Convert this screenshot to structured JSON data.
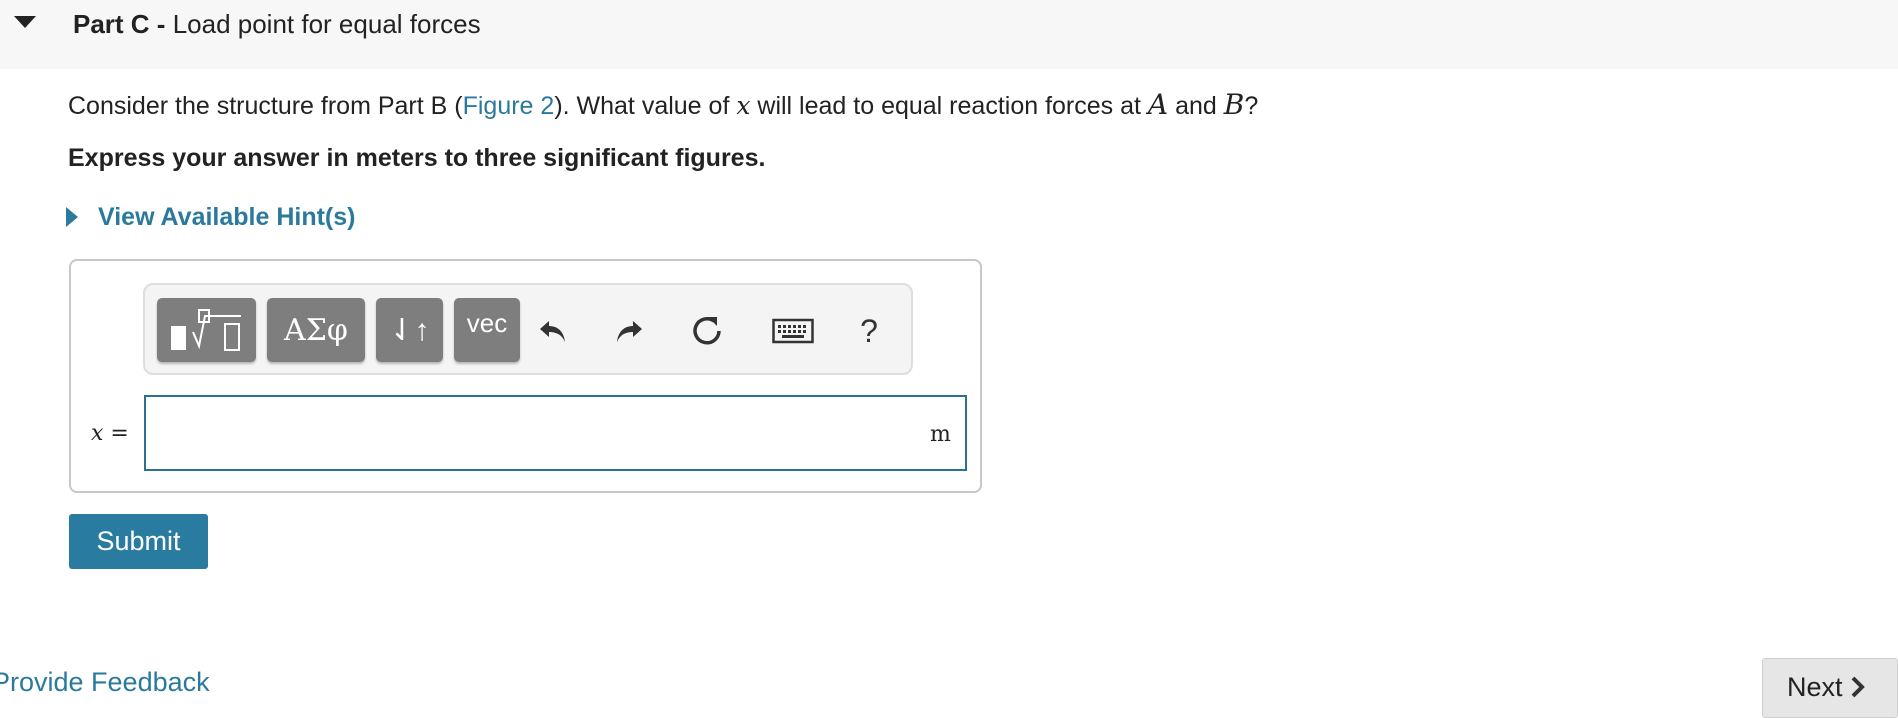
{
  "part": {
    "label": "Part C -",
    "title": "Load point for equal forces"
  },
  "question": {
    "prefix": "Consider the structure from Part B (",
    "figure_link": "Figure 2",
    "middle": "). What value of ",
    "variable": "x",
    "middle2": " will lead to equal reaction forces at ",
    "point_a": "A",
    "and": " and ",
    "point_b": "B",
    "suffix": "?"
  },
  "instruction": "Express your answer in meters to three significant figures.",
  "hint_label": "View Available Hint(s)",
  "toolbar": {
    "greek_label": "ΑΣφ",
    "arrows_label": "⇃↑",
    "vec_label": "vec",
    "help_label": "?",
    "icons": [
      "templates-icon",
      "undo-icon",
      "redo-icon",
      "reset-icon",
      "keyboard-icon",
      "help-icon"
    ]
  },
  "answer": {
    "variable_label": "x",
    "equals": " =",
    "value": "",
    "unit": "m"
  },
  "submit_label": "Submit",
  "feedback_label": "Provide Feedback",
  "next_label": "Next",
  "colors": {
    "link": "#2b7a9c",
    "submit_bg": "#2a7ba0",
    "toolbar_button": "#7e7e7e"
  }
}
